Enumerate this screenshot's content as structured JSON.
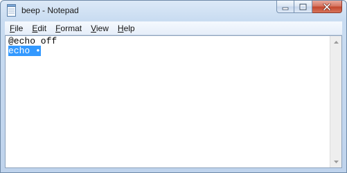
{
  "window": {
    "title": "beep - Notepad",
    "icon": "notepad-icon",
    "caption_icons": [
      "minimize-icon",
      "maximize-icon",
      "close-icon"
    ]
  },
  "menu": {
    "file": {
      "first": "F",
      "rest": "ile"
    },
    "edit": {
      "first": "E",
      "rest": "dit"
    },
    "format": {
      "first": "F",
      "rest": "ormat"
    },
    "view": {
      "first": "V",
      "rest": "iew"
    },
    "help": {
      "first": "H",
      "rest": "elp"
    }
  },
  "document": {
    "lines": [
      "@echo off",
      "echo •"
    ],
    "selected_line": 2
  },
  "colors": {
    "selection": "#3399ff",
    "close_button": "#c2452c"
  }
}
